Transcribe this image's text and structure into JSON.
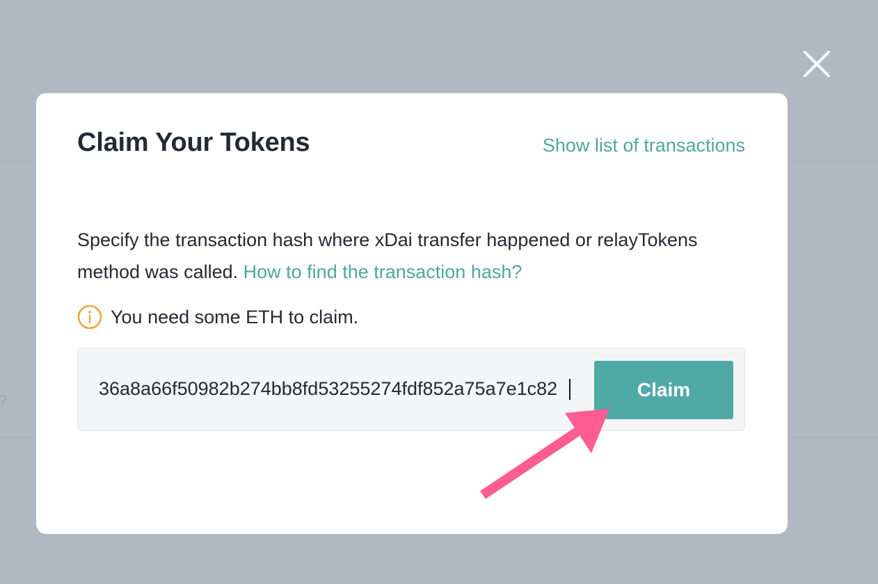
{
  "overlay": {
    "close_icon": "close-icon",
    "background_glyph": "?"
  },
  "modal": {
    "title": "Claim Your Tokens",
    "tx_list_link": "Show list of transactions",
    "description": "Specify the transaction hash where xDai transfer happened or relayTokens method was called.",
    "help_link": "How to find the transaction hash?",
    "warning": {
      "icon": "info-icon",
      "text": "You need some ETH to claim.",
      "color": "#f0a23c"
    },
    "hash_input_value": "36a8a66f50982b274bb8fd53255274fdf852a75a7e1c82",
    "claim_button": "Claim"
  },
  "colors": {
    "accent": "#4ea6a3",
    "button": "#4fa9a7",
    "annotation_arrow": "#ff5c93"
  }
}
